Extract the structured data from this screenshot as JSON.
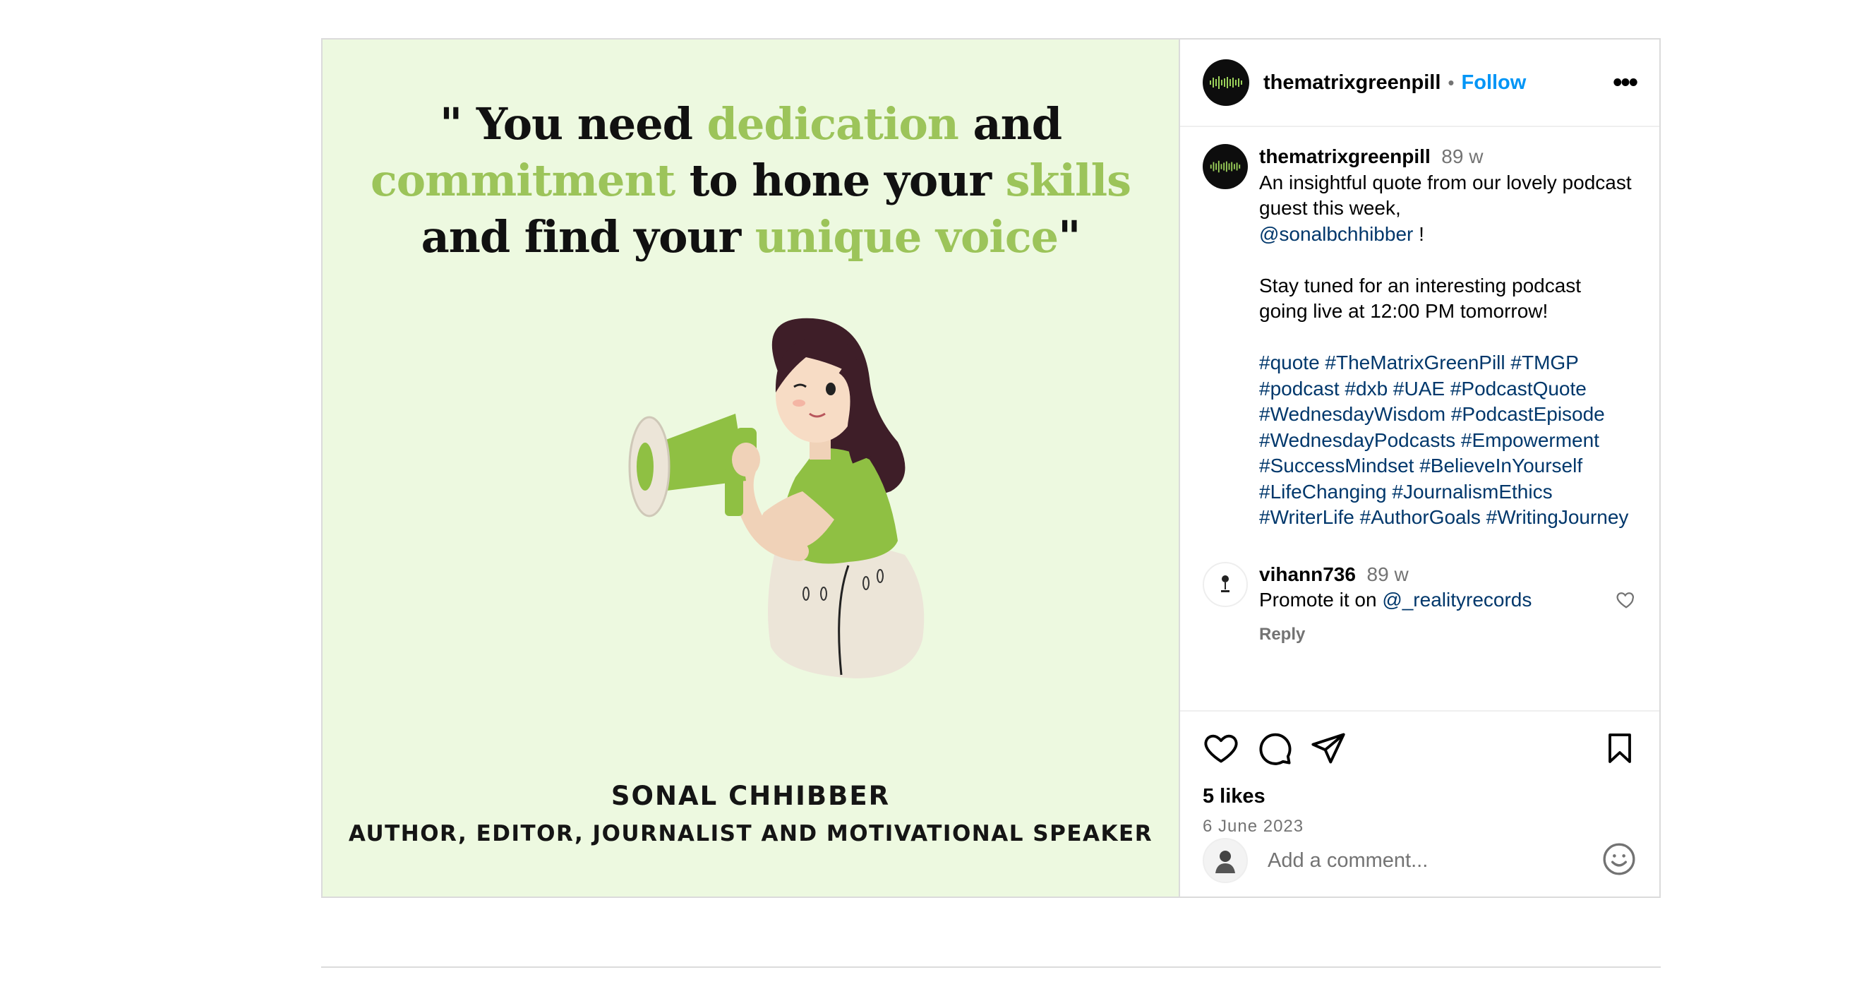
{
  "post": {
    "image": {
      "quote_part1": "\" You need ",
      "quote_hl1": "dedication",
      "quote_part2": " and",
      "quote_hl2": "commitment",
      "quote_part3": " to hone your ",
      "quote_hl3": "skills",
      "quote_part4": "and find your ",
      "quote_hl4": "unique voice",
      "quote_part5": "\"",
      "speaker_name": "SONAL CHHIBBER",
      "speaker_role": "AUTHOR, EDITOR, JOURNALIST AND MOTIVATIONAL SPEAKER"
    },
    "header": {
      "username": "thematrixgreenpill",
      "separator": "•",
      "follow_label": "Follow",
      "more_label": "•••"
    },
    "caption": {
      "username": "thematrixgreenpill",
      "age": "89 w",
      "line1": "An insightful quote from our lovely podcast guest this week,",
      "mention": "@sonalbchhibber",
      "line1_end": " !",
      "line2": "Stay tuned for an interesting podcast going live at 12:00 PM tomorrow!",
      "hashtags": "#quote #TheMatrixGreenPill #TMGP #podcast #dxb #UAE #PodcastQuote #WednesdayWisdom #PodcastEpisode #WednesdayPodcasts #Empowerment #SuccessMindset #BelieveInYourself #LifeChanging #JournalismEthics #WriterLife #AuthorGoals #WritingJourney"
    },
    "comment": {
      "username": "vihann736",
      "age": "89 w",
      "text": "Promote it on ",
      "mention": "@_realityrecords",
      "reply_label": "Reply"
    },
    "stats": {
      "likes": "5 likes",
      "date": "6 June 2023"
    },
    "add_comment": {
      "placeholder": "Add a comment..."
    },
    "icons": {
      "like": "heart-icon",
      "comment": "comment-icon",
      "share": "paper-plane-icon",
      "save": "bookmark-icon",
      "emoji": "smiley-icon"
    },
    "colors": {
      "accent": "#0095f6",
      "quote_highlight": "#9cc45a",
      "image_bg": "#edf9e0"
    }
  }
}
